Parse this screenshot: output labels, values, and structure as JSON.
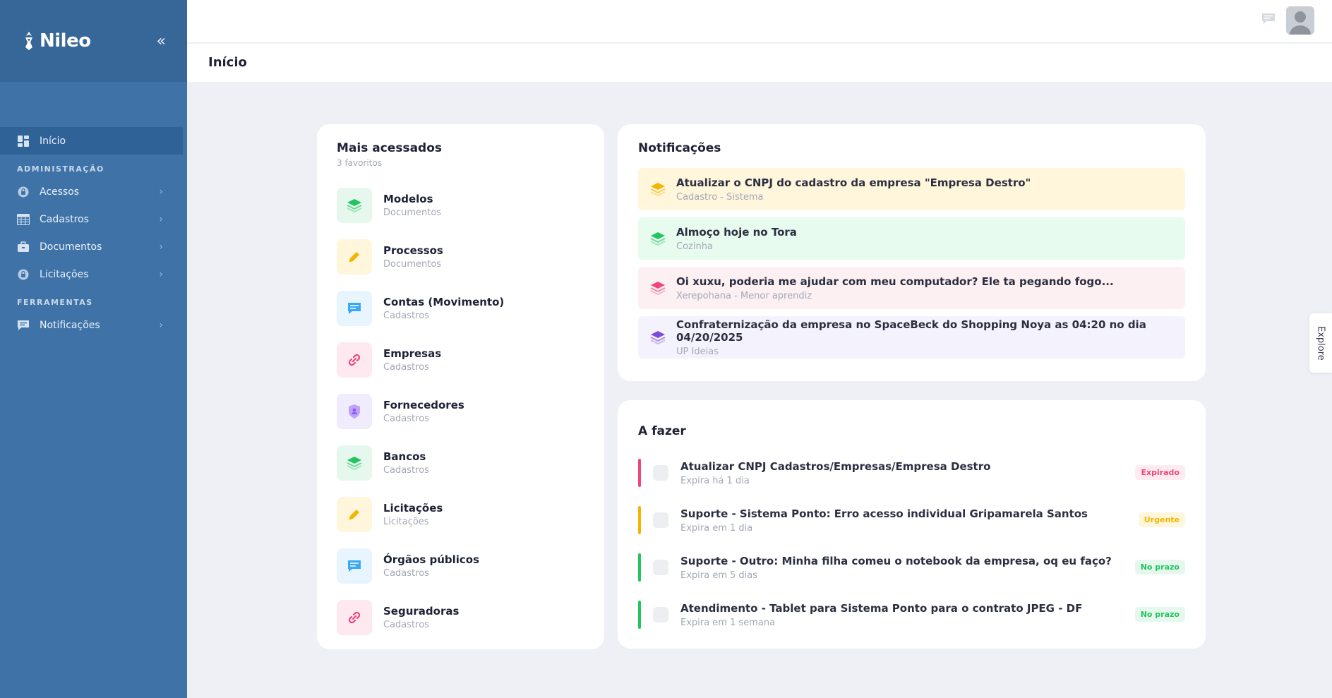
{
  "sidebar": {
    "brand": "Nileo",
    "items": [
      {
        "label": "Início",
        "icon": "dashboard-icon",
        "active": true
      }
    ],
    "sections": [
      {
        "title": "ADMINISTRAÇÃO",
        "items": [
          {
            "label": "Acessos",
            "icon": "lock-icon"
          },
          {
            "label": "Cadastros",
            "icon": "table-icon"
          },
          {
            "label": "Documentos",
            "icon": "briefcase-icon"
          },
          {
            "label": "Licitações",
            "icon": "lock-icon"
          }
        ]
      },
      {
        "title": "FERRAMENTAS",
        "items": [
          {
            "label": "Notificações",
            "icon": "chat-icon"
          }
        ]
      }
    ]
  },
  "header": {
    "title": "Início"
  },
  "favorites": {
    "title": "Mais acessados",
    "subtitle": "3 favoritos",
    "items": [
      {
        "name": "Modelos",
        "category": "Documentos",
        "icon": "layers-icon",
        "color": "#22c55e",
        "bg": "#e6f8ee"
      },
      {
        "name": "Processos",
        "category": "Documentos",
        "icon": "pencil-icon",
        "color": "#f5b400",
        "bg": "#fff6dc"
      },
      {
        "name": "Contas (Movimento)",
        "category": "Cadastros",
        "icon": "chat-icon",
        "color": "#38a9f5",
        "bg": "#e8f5fe"
      },
      {
        "name": "Empresas",
        "category": "Cadastros",
        "icon": "link-icon",
        "color": "#f0457a",
        "bg": "#fde9ef"
      },
      {
        "name": "Fornecedores",
        "category": "Cadastros",
        "icon": "shield-icon",
        "color": "#8b5cf6",
        "bg": "#f0ebfd"
      },
      {
        "name": "Bancos",
        "category": "Cadastros",
        "icon": "layers-icon",
        "color": "#22c55e",
        "bg": "#e6f8ee"
      },
      {
        "name": "Licitações",
        "category": "Licitações",
        "icon": "pencil-icon",
        "color": "#f5b400",
        "bg": "#fff6dc"
      },
      {
        "name": "Órgãos públicos",
        "category": "Cadastros",
        "icon": "chat-icon",
        "color": "#38a9f5",
        "bg": "#e8f5fe"
      },
      {
        "name": "Seguradoras",
        "category": "Cadastros",
        "icon": "link-icon",
        "color": "#f0457a",
        "bg": "#fde9ef"
      }
    ]
  },
  "notifications": {
    "title": "Notificações",
    "items": [
      {
        "title": "Atualizar o CNPJ do cadastro da empresa \"Empresa Destro\"",
        "sub": "Cadastro - Sistema",
        "bg": "#fff6dc",
        "color": "#f5b400"
      },
      {
        "title": "Almoço hoje no Tora",
        "sub": "Cozinha",
        "bg": "#e8fbef",
        "color": "#22c55e"
      },
      {
        "title": "Oi xuxu, poderia me ajudar com meu computador? Ele ta pegando fogo...",
        "sub": "Xerepohana - Menor aprendiz",
        "bg": "#fdf0f3",
        "color": "#f0457a"
      },
      {
        "title": "Confraternização da empresa no SpaceBeck do Shopping Noya as 04:20 no dia 04/20/2025",
        "sub": "UP Ideias",
        "bg": "#f4f2fd",
        "color": "#7c4ddb"
      }
    ]
  },
  "todo": {
    "title": "A fazer",
    "items": [
      {
        "title": "Atualizar CNPJ Cadastros/Empresas/Empresa Destro",
        "sub": "Expira há 1 dia",
        "badge": "Expirado",
        "color": "#f0457a",
        "badge_bg": "#fdebf0"
      },
      {
        "title": "Suporte - Sistema Ponto: Erro acesso individual Gripamarela Santos",
        "sub": "Expira em 1 dia",
        "badge": "Urgente",
        "color": "#f5b400",
        "badge_bg": "#fff6dc"
      },
      {
        "title": "Suporte - Outro: Minha filha comeu o notebook da empresa, oq eu faço?",
        "sub": "Expira em 5 dias",
        "badge": "No prazo",
        "color": "#22c55e",
        "badge_bg": "#e6f8ee"
      },
      {
        "title": "Atendimento - Tablet para Sistema Ponto para o contrato JPEG - DF",
        "sub": "Expira em 1 semana",
        "badge": "No prazo",
        "color": "#22c55e",
        "badge_bg": "#e6f8ee"
      }
    ]
  },
  "explore": {
    "label": "Explore"
  }
}
